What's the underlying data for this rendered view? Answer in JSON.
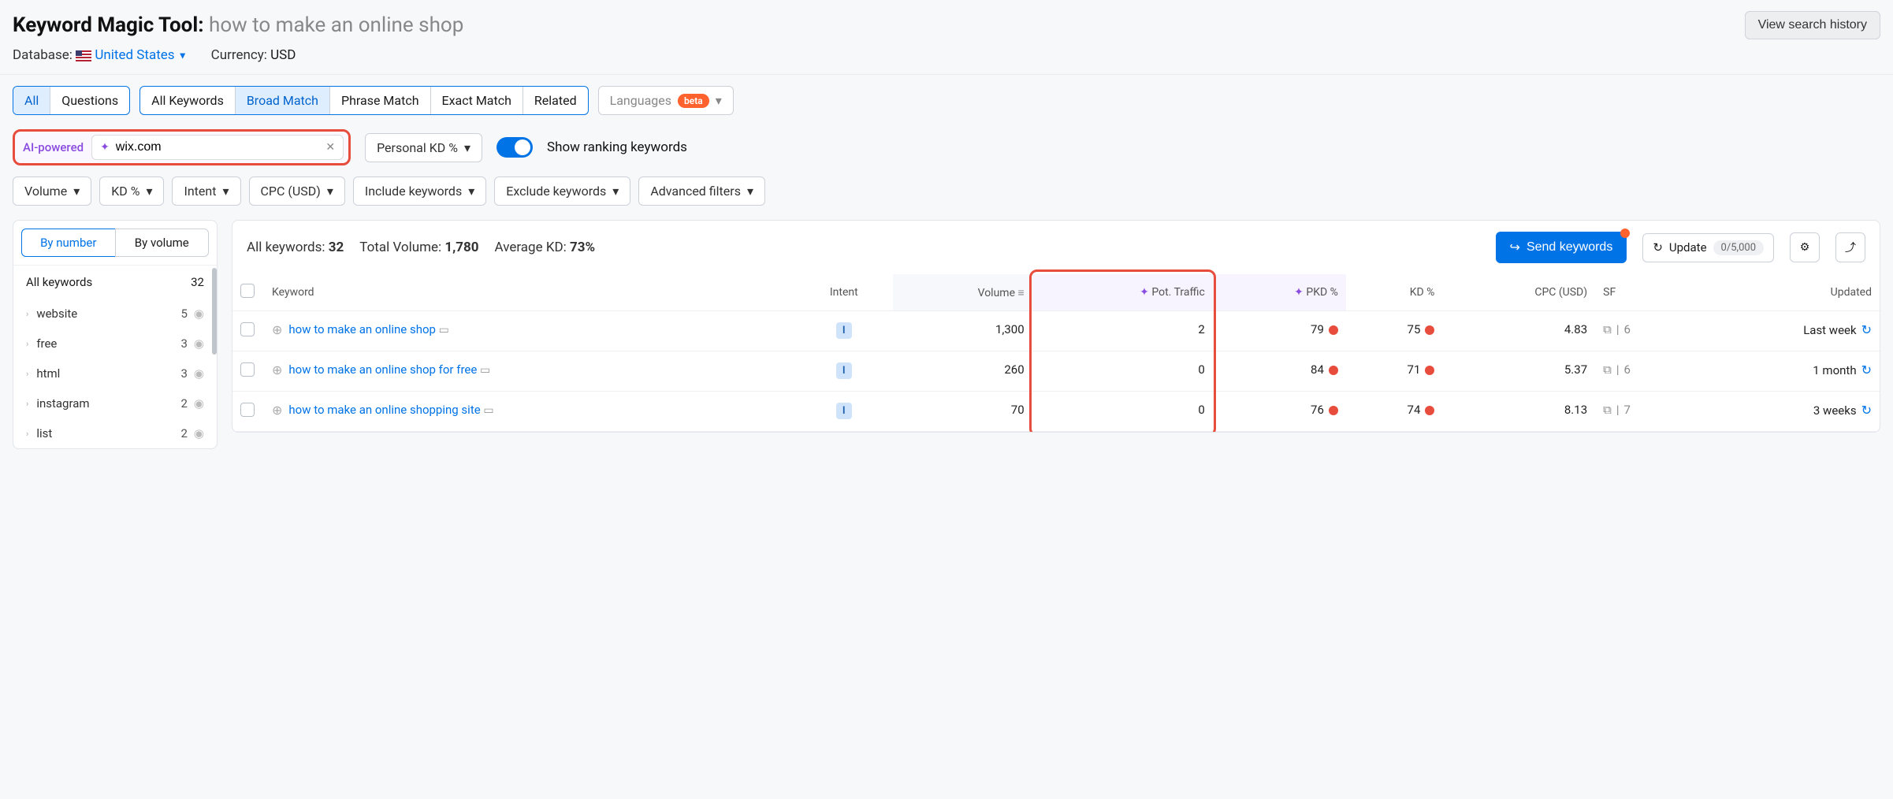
{
  "header": {
    "tool_name": "Keyword Magic Tool:",
    "query": "how to make an online shop",
    "history_btn": "View search history",
    "db_label": "Database:",
    "db_value": "United States",
    "currency_label": "Currency:",
    "currency_value": "USD"
  },
  "tabs": {
    "all": "All",
    "questions": "Questions",
    "all_kw": "All Keywords",
    "broad": "Broad Match",
    "phrase": "Phrase Match",
    "exact": "Exact Match",
    "related": "Related",
    "languages": "Languages",
    "beta": "beta"
  },
  "ai": {
    "label": "AI-powered",
    "value": "wix.com"
  },
  "personal_kd": "Personal KD %",
  "show_ranking": "Show ranking keywords",
  "filters": {
    "volume": "Volume",
    "kd": "KD %",
    "intent": "Intent",
    "cpc": "CPC (USD)",
    "include": "Include keywords",
    "exclude": "Exclude keywords",
    "advanced": "Advanced filters"
  },
  "sidebar": {
    "by_number": "By number",
    "by_volume": "By volume",
    "all_keywords": "All keywords",
    "all_count": "32",
    "items": [
      {
        "label": "website",
        "count": "5"
      },
      {
        "label": "free",
        "count": "3"
      },
      {
        "label": "html",
        "count": "3"
      },
      {
        "label": "instagram",
        "count": "2"
      },
      {
        "label": "list",
        "count": "2"
      }
    ]
  },
  "summary": {
    "all_kw_label": "All keywords:",
    "all_kw_val": "32",
    "tot_vol_label": "Total Volume:",
    "tot_vol_val": "1,780",
    "avg_kd_label": "Average KD:",
    "avg_kd_val": "73%",
    "send": "Send keywords",
    "update": "Update",
    "counter": "0/5,000"
  },
  "columns": {
    "keyword": "Keyword",
    "intent": "Intent",
    "volume": "Volume",
    "pot_traffic": "Pot. Traffic",
    "pkd": "PKD %",
    "kd": "KD %",
    "cpc": "CPC (USD)",
    "sf": "SF",
    "updated": "Updated"
  },
  "rows": [
    {
      "keyword": "how to make an online shop",
      "intent": "I",
      "volume": "1,300",
      "pot": "2",
      "pkd": "79",
      "kd": "75",
      "cpc": "4.83",
      "sf": "6",
      "updated": "Last week"
    },
    {
      "keyword": "how to make an online shop for free",
      "intent": "I",
      "volume": "260",
      "pot": "0",
      "pkd": "84",
      "kd": "71",
      "cpc": "5.37",
      "sf": "6",
      "updated": "1 month"
    },
    {
      "keyword": "how to make an online shopping site",
      "intent": "I",
      "volume": "70",
      "pot": "0",
      "pkd": "76",
      "kd": "74",
      "cpc": "8.13",
      "sf": "7",
      "updated": "3 weeks"
    }
  ]
}
